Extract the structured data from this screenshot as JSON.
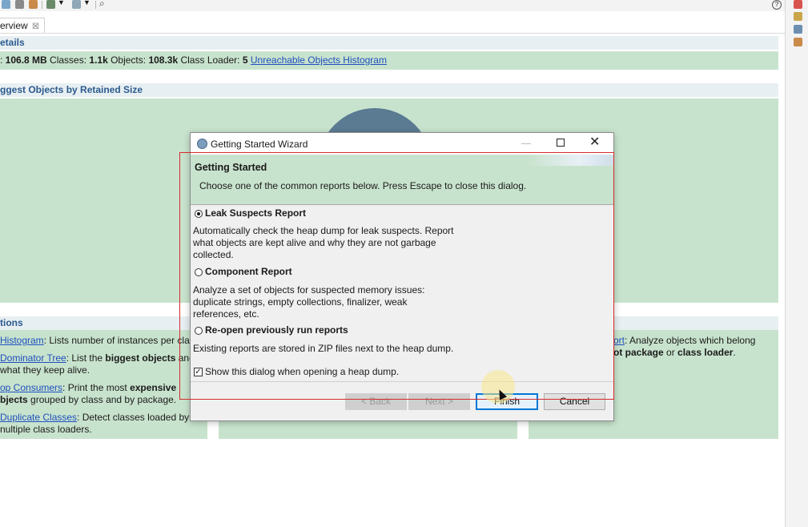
{
  "editor_tab": {
    "label": "erview",
    "close_glyph": "☒"
  },
  "details": {
    "header": "etails",
    "line": {
      "size_prefix": ": ",
      "size_value": "106.8 MB",
      "classes_label": " Classes: ",
      "classes_value": "1.1k",
      "objects_label": " Objects: ",
      "objects_value": "108.3k",
      "loader_label": " Class Loader: ",
      "loader_value": "5",
      "histogram_link": "Unreachable Objects Histogram"
    }
  },
  "biggest": {
    "header": "ggest Objects by Retained Size"
  },
  "actions": {
    "header": "tions",
    "items": [
      {
        "link": "Histogram",
        "rest": ": Lists number of instances per clas"
      },
      {
        "link": "Dominator Tree",
        "rest1": ": List the ",
        "bold": "biggest objects",
        "rest2": " and",
        "line2": "what they keep alive."
      },
      {
        "link": "op Consumers",
        "rest1": ": Print the most ",
        "bold": "expensive",
        "line2_bold": "bjects",
        "line2_rest": " grouped by class and by package."
      },
      {
        "link": "Duplicate Classes",
        "rest": ": Detect classes loaded by",
        "line2": "nultiple class loaders."
      }
    ],
    "right_item": {
      "link": "ort",
      "rest1": ": Analyze objects which belong",
      "bold1": "ot package",
      "mid": " or ",
      "bold2": "class loader",
      "end": "."
    }
  },
  "dialog": {
    "title": "Getting Started Wizard",
    "header_title": "Getting Started",
    "header_desc": "Choose one of the common reports below. Press Escape to close this dialog.",
    "options": [
      {
        "label": "Leak Suspects Report",
        "selected": true,
        "desc": [
          "Automatically check the heap dump for leak suspects. Report",
          "what objects are kept alive and why they are not garbage",
          "collected."
        ]
      },
      {
        "label": "Component Report",
        "selected": false,
        "desc": [
          "Analyze a set of objects for suspected memory issues:",
          "duplicate strings, empty collections, finalizer, weak",
          "references, etc."
        ]
      },
      {
        "label": "Re-open previously run reports",
        "selected": false,
        "desc": [
          "Existing reports are stored in ZIP files next to the heap dump."
        ]
      }
    ],
    "show_dialog_label": "Show this dialog when opening a heap dump.",
    "show_dialog_checked": true,
    "buttons": {
      "back": "< Back",
      "next": "Next >",
      "finish": "Finish",
      "cancel": "Cancel"
    }
  },
  "colors": {
    "accent": "#0078d7",
    "section_header_text": "#2a5a8e",
    "panel_green": "#c8e3cd",
    "link": "#1f4fbf",
    "highlight_rect": "#d62b2b"
  }
}
